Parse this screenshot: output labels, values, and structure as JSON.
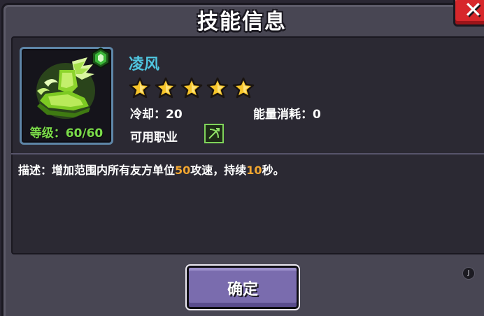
{
  "dialog": {
    "title": "技能信息",
    "close_glyph": "✕"
  },
  "skill": {
    "name": "凌风",
    "stars": 5,
    "level_text": "等级：60/60",
    "cooldown_text": "冷却：20",
    "energy_text": "能量消耗：0",
    "class_label": "可用职业",
    "icon": "wind-boot-icon",
    "badge_icon": "green-gem-badge-icon",
    "class_icon": "ranger-class-icon"
  },
  "description": {
    "prefix": "描述：增加范围内所有友方单位",
    "value1": "50",
    "middle": "攻速，持续",
    "value2": "10",
    "suffix": "秒。"
  },
  "buttons": {
    "confirm": "确定"
  },
  "misc": {
    "corner_glyph": "J"
  },
  "colors": {
    "frame": "#484653",
    "panel": "#2b2933",
    "skill_name": "#4fc4de",
    "level": "#7bdc4a",
    "highlight": "#f2a630",
    "confirm_button": "#7a6cae",
    "close_button": "#d7272b"
  }
}
